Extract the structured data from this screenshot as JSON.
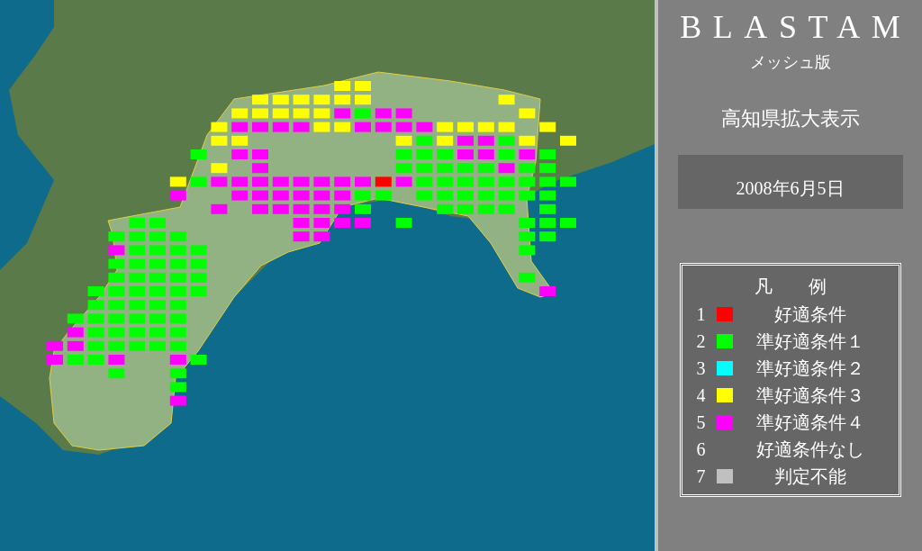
{
  "title": "BLASTAM",
  "subtitle": "メッシュ版",
  "view": "高知県拡大表示",
  "date": "2008年6月5日",
  "legend": {
    "heading": "凡　　例",
    "items": [
      {
        "number": "1",
        "label": "好適条件",
        "color": "#ff0000"
      },
      {
        "number": "2",
        "label": "準好適条件１",
        "color": "#00ff00"
      },
      {
        "number": "3",
        "label": "準好適条件２",
        "color": "#00ffff"
      },
      {
        "number": "4",
        "label": "準好適条件３",
        "color": "#ffff00"
      },
      {
        "number": "5",
        "label": "準好適条件４",
        "color": "#ff00ff"
      },
      {
        "number": "6",
        "label": "好適条件なし"
      },
      {
        "number": "7",
        "label": "判定不能",
        "color": "#c0c0c0"
      }
    ]
  }
}
